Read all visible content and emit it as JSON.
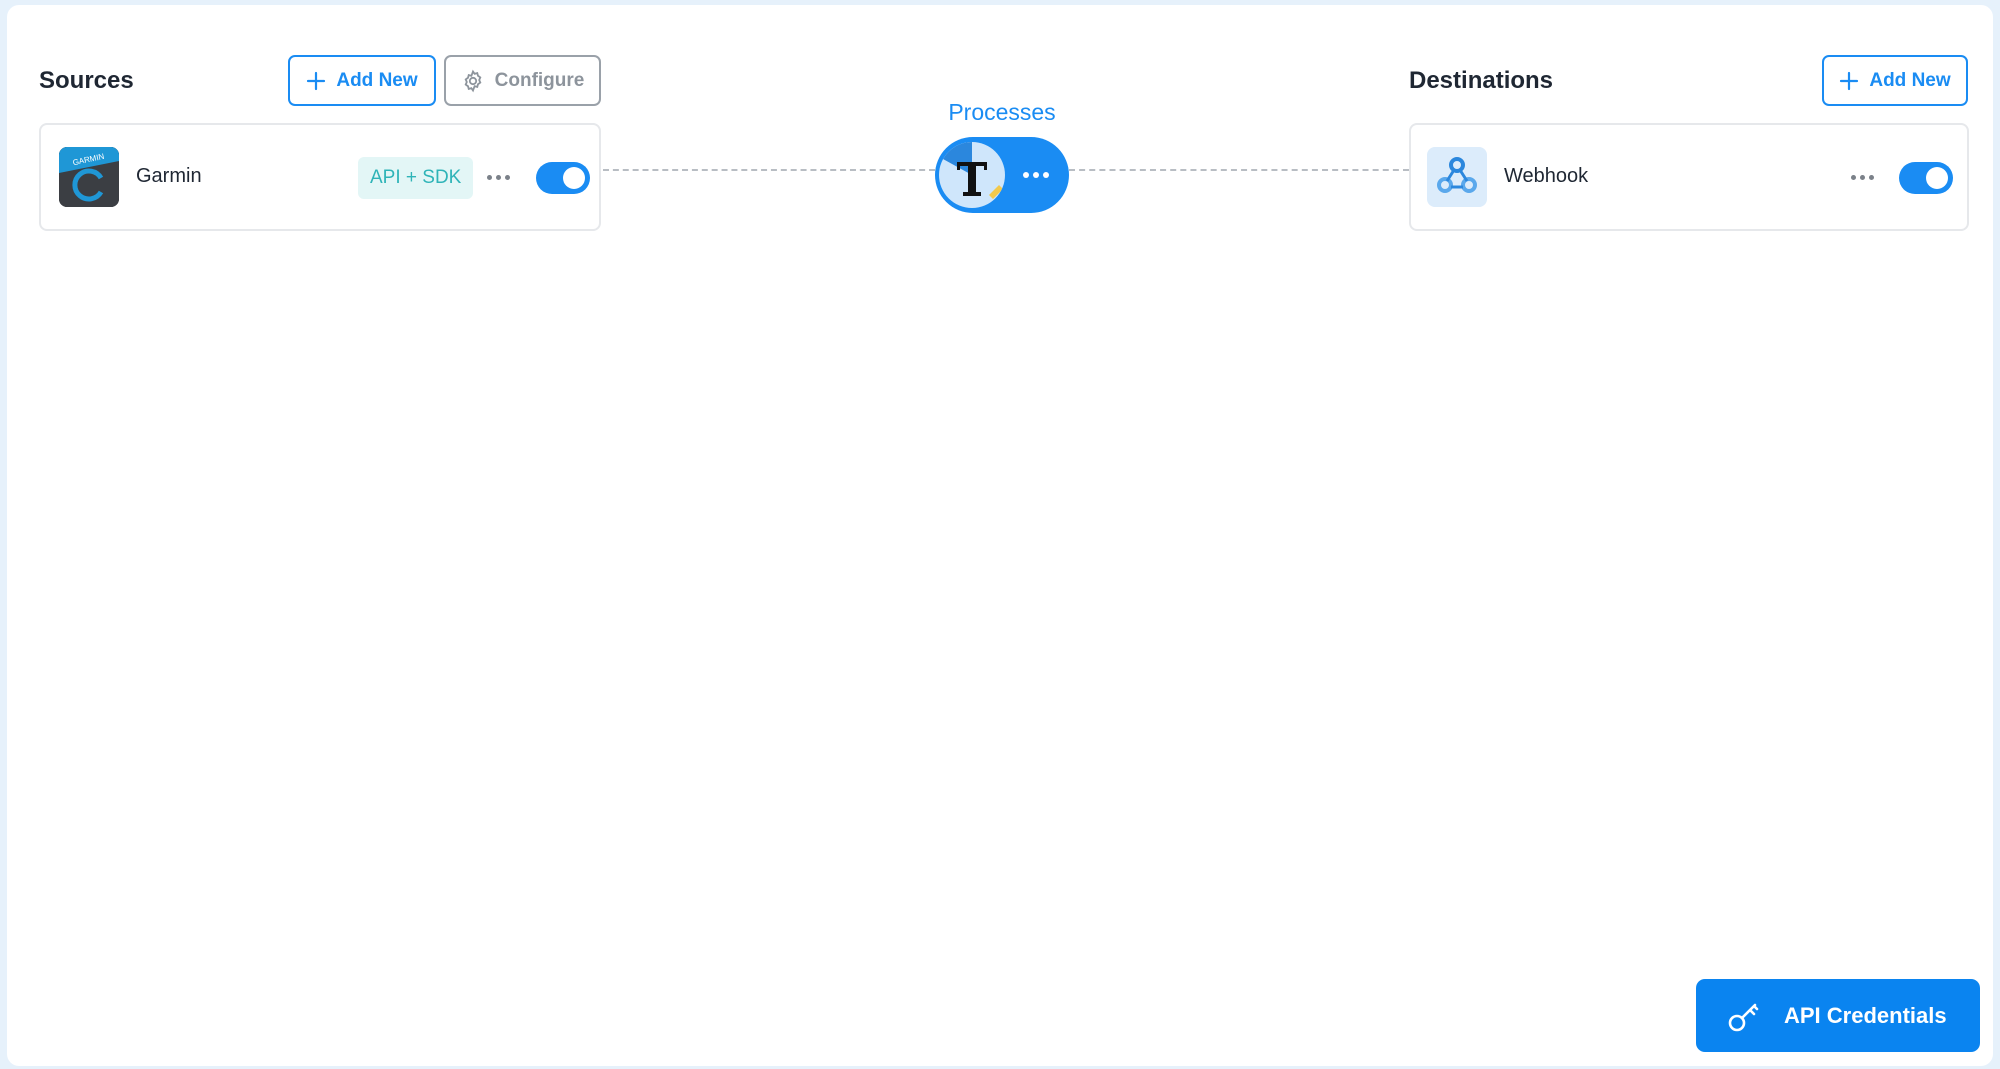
{
  "sources": {
    "title": "Sources",
    "add_new_label": "Add New",
    "configure_label": "Configure",
    "items": [
      {
        "name": "Garmin",
        "badge": "API + SDK",
        "enabled": true,
        "icon": "garmin-logo-icon"
      }
    ]
  },
  "processes": {
    "title": "Processes",
    "icon": "transform-t-icon"
  },
  "destinations": {
    "title": "Destinations",
    "add_new_label": "Add New",
    "items": [
      {
        "name": "Webhook",
        "enabled": true,
        "icon": "webhook-icon"
      }
    ]
  },
  "footer": {
    "api_credentials_label": "API Credentials",
    "icon": "key-icon"
  },
  "colors": {
    "accent": "#1a8cf3",
    "badge_bg": "#e3f6f6",
    "badge_text": "#2fb4b8"
  }
}
